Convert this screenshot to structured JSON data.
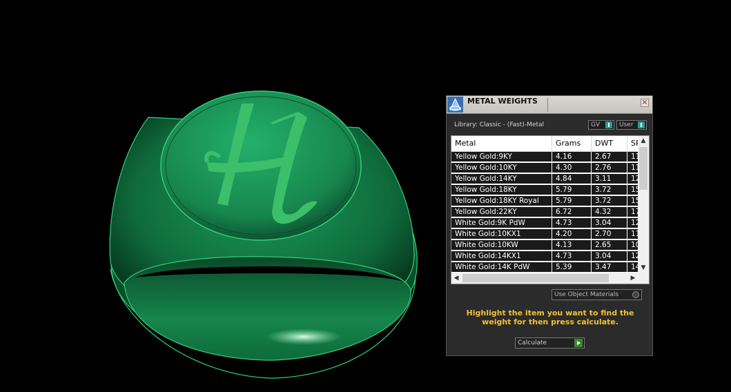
{
  "panel": {
    "title": "METAL WEIGHTS",
    "close_glyph": "✕",
    "library_label": "Library: Classic - (Fast)-Metal",
    "gv_label": "GV",
    "user_label": "User",
    "columns": [
      "Metal",
      "Grams",
      "DWT",
      "SP"
    ],
    "rows": [
      [
        "Yellow Gold:9KY",
        "4.16",
        "2.67",
        "11"
      ],
      [
        "Yellow Gold:10KY",
        "4.30",
        "2.76",
        "11"
      ],
      [
        "Yellow Gold:14KY",
        "4.84",
        "3.11",
        "12"
      ],
      [
        "Yellow Gold:18KY",
        "5.79",
        "3.72",
        "15"
      ],
      [
        "Yellow Gold:18KY Royal",
        "5.79",
        "3.72",
        "15"
      ],
      [
        "Yellow Gold:22KY",
        "6.72",
        "4.32",
        "17"
      ],
      [
        "White Gold:9K PdW",
        "4.73",
        "3.04",
        "12"
      ],
      [
        "White Gold:10KX1",
        "4.20",
        "2.70",
        "11"
      ],
      [
        "White Gold:10KW",
        "4.13",
        "2.65",
        "10"
      ],
      [
        "White Gold:14KX1",
        "4.73",
        "3.04",
        "12"
      ],
      [
        "White Gold:14K PdW",
        "5.39",
        "3.47",
        "14"
      ]
    ],
    "use_object_materials": "Use Object Materials",
    "hint": "Highlight the item you want to find the weight for then press calculate.",
    "calculate_label": "Calculate"
  },
  "viewport": {
    "engraving_letter": "H",
    "ring_color": "#1e9e5e",
    "engraving_color": "#3cbf6a"
  }
}
